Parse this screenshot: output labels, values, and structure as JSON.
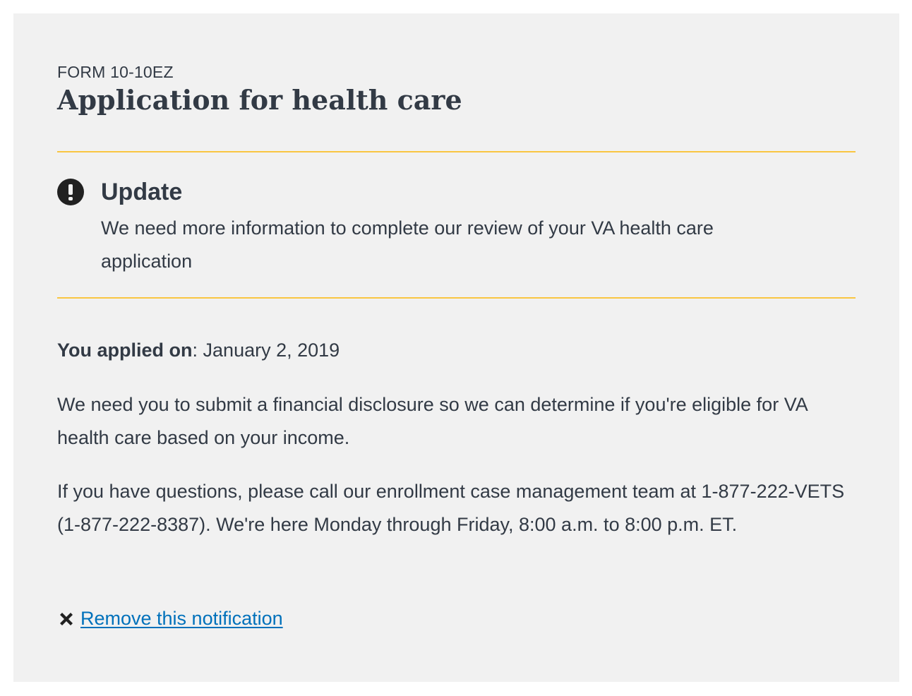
{
  "form": {
    "id": "FORM 10-10EZ",
    "title": "Application for health care"
  },
  "alert": {
    "heading": "Update",
    "body": "We need more information to complete our review of your VA health care application",
    "accent_color": "#f9c642"
  },
  "details": {
    "applied_label": "You applied on",
    "applied_separator": ":",
    "applied_date": "January 2, 2019",
    "paragraph_1": "We need you to submit a financial disclosure so we can determine if you're eligible for VA health care based on your income.",
    "paragraph_2": "If you have questions, please call our enrollment case management team at 1-877-222-VETS (1-877-222-8387). We're here Monday through Friday, 8:00 a.m. to 8:00 p.m. ET."
  },
  "actions": {
    "remove_label": "Remove this notification",
    "remove_icon": "close-icon",
    "link_color": "#0071bb"
  }
}
